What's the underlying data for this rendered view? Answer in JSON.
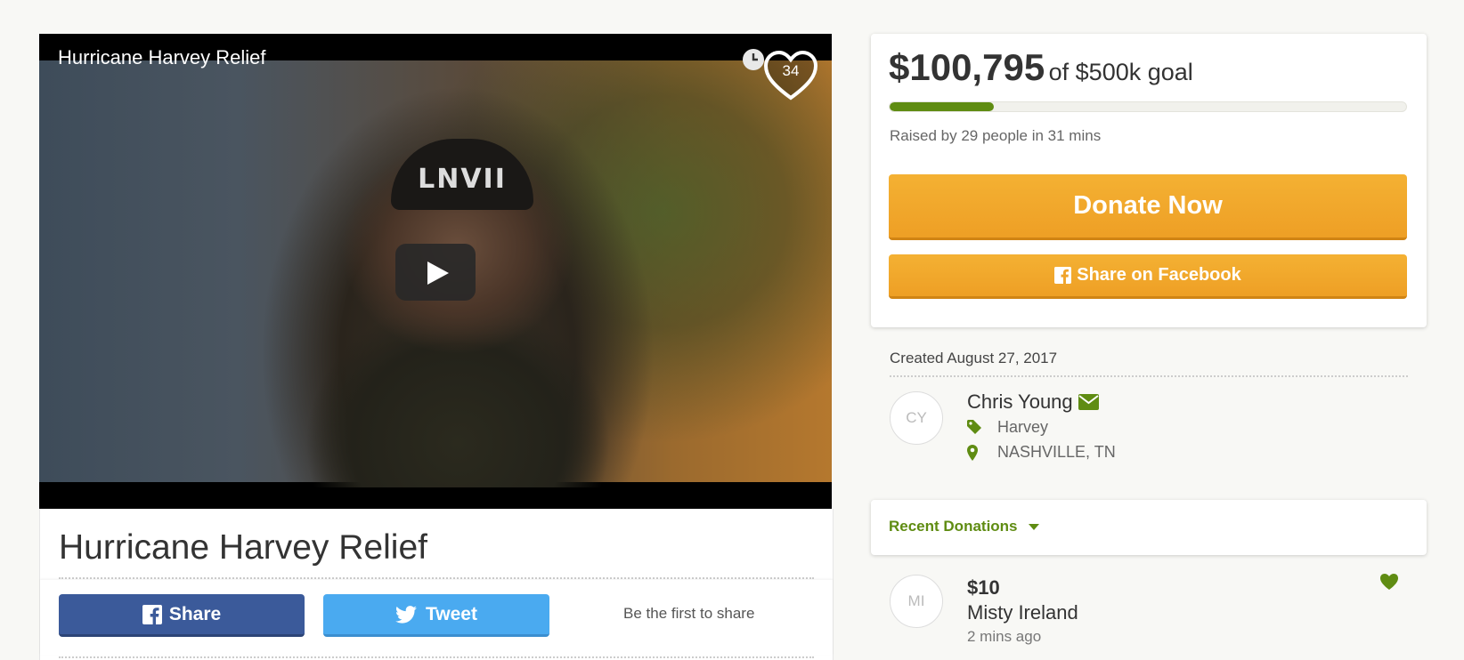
{
  "colors": {
    "progress_green": "#5f8c12",
    "donate_orange": "#f0a42b",
    "facebook_blue": "#3b5a9a",
    "twitter_blue": "#4aaaf0"
  },
  "video": {
    "title": "Hurricane Harvey Relief",
    "cap_logo": "LNVII",
    "heart_count": "34",
    "icons": [
      "clock-icon",
      "heart-icon",
      "play-icon"
    ]
  },
  "campaign": {
    "title": "Hurricane Harvey Relief"
  },
  "share": {
    "facebook_label": "Share",
    "twitter_label": "Tweet",
    "first_share_text": "Be the first to share"
  },
  "donation": {
    "raised_amount": "$100,795",
    "goal_text": "of $500k goal",
    "progress_fraction": 0.2016,
    "raised_by": "Raised by 29 people in 31 mins",
    "donate_label": "Donate Now",
    "facebook_share_label": "Share on Facebook"
  },
  "organizer": {
    "created": "Created August 27, 2017",
    "initials": "CY",
    "name": "Chris Young",
    "category": "Harvey",
    "location": "NASHVILLE, TN"
  },
  "recent_donations": {
    "toggle_label": "Recent Donations",
    "items": [
      {
        "initials": "MI",
        "amount": "$10",
        "name": "Misty Ireland",
        "time": "2 mins ago"
      }
    ]
  }
}
